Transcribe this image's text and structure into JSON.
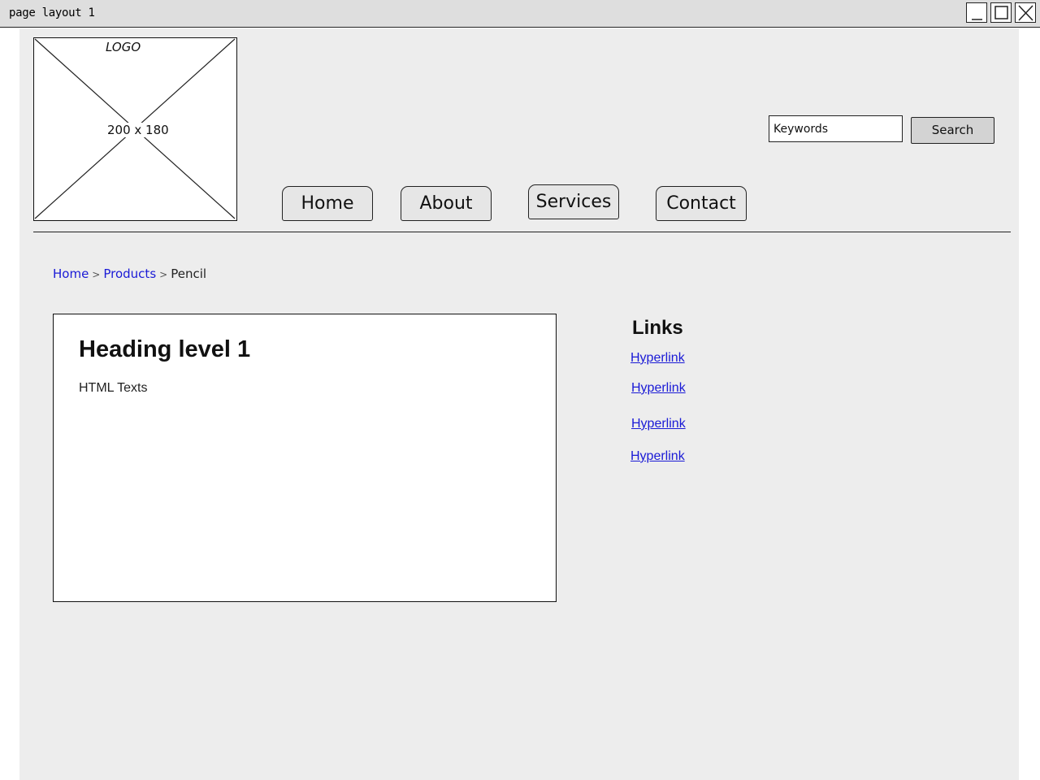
{
  "window": {
    "title": "page layout 1",
    "controls": [
      "minimize-icon",
      "maximize-icon",
      "close-icon"
    ]
  },
  "header": {
    "logo": {
      "label": "LOGO",
      "dimensions": "200 x 180"
    },
    "search": {
      "placeholder": "Keywords",
      "value": "",
      "button_label": "Search"
    },
    "nav": {
      "tabs": [
        {
          "label": "Home"
        },
        {
          "label": "About"
        },
        {
          "label": "Services"
        },
        {
          "label": "Contact"
        }
      ]
    }
  },
  "breadcrumb": {
    "items": [
      {
        "label": "Home",
        "link": true
      },
      {
        "label": "Products",
        "link": true
      },
      {
        "label": "Pencil",
        "link": false
      }
    ],
    "separator": ">"
  },
  "main": {
    "heading": "Heading level 1",
    "text": "HTML Texts"
  },
  "sidebar": {
    "heading": "Links",
    "links": [
      {
        "label": "Hyperlink"
      },
      {
        "label": "Hyperlink"
      },
      {
        "label": "Hyperlink"
      },
      {
        "label": "Hyperlink"
      }
    ]
  },
  "colors": {
    "canvas": "#ededed",
    "titlebar": "#dedede",
    "link": "#1a1ad6",
    "button": "#d3d3d3",
    "tab": "#e6e6e6"
  }
}
